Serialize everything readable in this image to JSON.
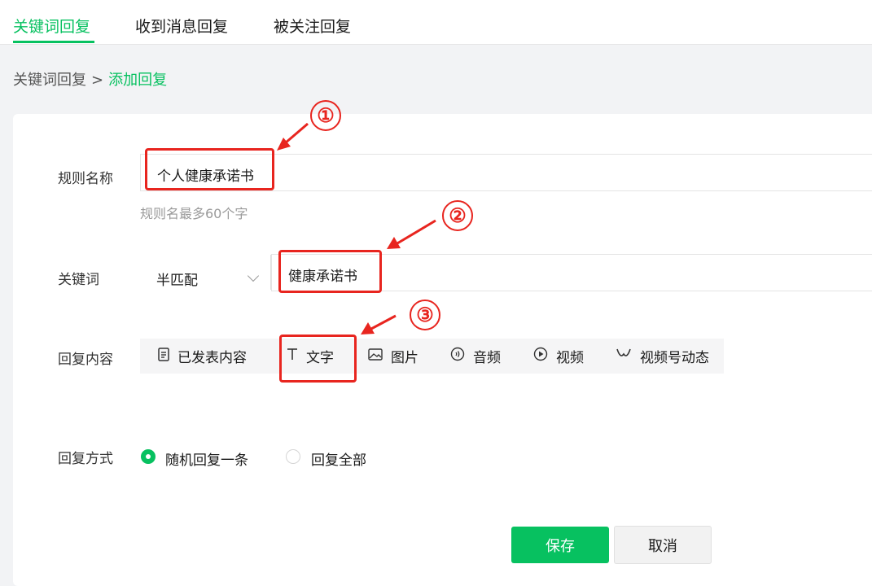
{
  "tabs": [
    {
      "label": "关键词回复",
      "active": true
    },
    {
      "label": "收到消息回复",
      "active": false
    },
    {
      "label": "被关注回复",
      "active": false
    }
  ],
  "breadcrumb": {
    "parent": "关键词回复",
    "separator": ">",
    "current": "添加回复"
  },
  "form": {
    "rule_name_label": "规则名称",
    "rule_name_value": "个人健康承诺书",
    "rule_name_hint": "规则名最多60个字",
    "keyword_label": "关键词",
    "match_mode": "半匹配",
    "keyword_value": "健康承诺书",
    "reply_content_label": "回复内容",
    "reply_tools": [
      {
        "label": "已发表内容",
        "icon": "document-icon"
      },
      {
        "label": "文字",
        "icon": "text-icon"
      },
      {
        "label": "图片",
        "icon": "image-icon"
      },
      {
        "label": "音频",
        "icon": "audio-icon"
      },
      {
        "label": "视频",
        "icon": "video-icon"
      },
      {
        "label": "视频号动态",
        "icon": "channels-icon"
      }
    ],
    "reply_mode_label": "回复方式",
    "reply_modes": [
      {
        "label": "随机回复一条",
        "selected": true
      },
      {
        "label": "回复全部",
        "selected": false
      }
    ]
  },
  "actions": {
    "save": "保存",
    "cancel": "取消"
  },
  "annotations": [
    {
      "number": "①"
    },
    {
      "number": "②"
    },
    {
      "number": "③"
    }
  ],
  "colors": {
    "accent": "#07c160",
    "annotation": "#e8251f"
  }
}
